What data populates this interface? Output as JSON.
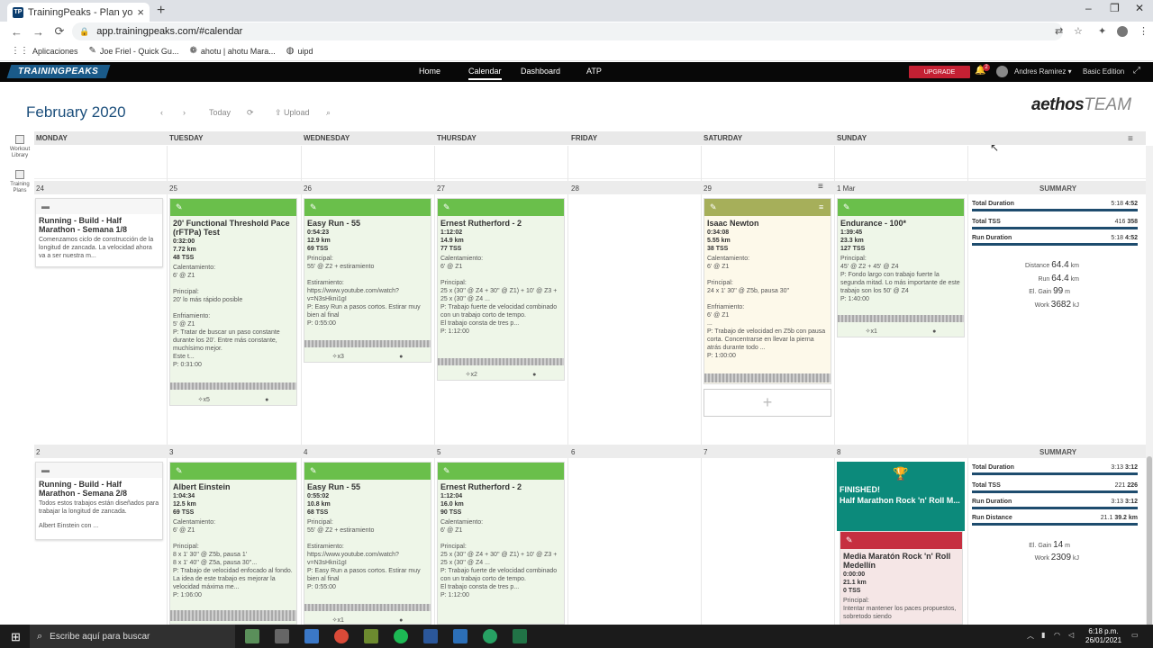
{
  "browser": {
    "tab_title": "TrainingPeaks - Plan your training",
    "tab_favicon": "TP",
    "url": "app.trainingpeaks.com/#calendar",
    "bookmarks": [
      "Aplicaciones",
      "Joe Friel - Quick Gu...",
      "ahotu | ahotu Mara...",
      "uipd"
    ]
  },
  "tp": {
    "logo": "TRAININGPEAKS",
    "nav": [
      "Home",
      "Calendar",
      "Dashboard",
      "ATP"
    ],
    "upgrade": "UPGRADE",
    "bell_count": "2",
    "user": "Andres Ramirez",
    "edition": "Basic Edition"
  },
  "calendar": {
    "month": "February",
    "year": "2020",
    "today": "Today",
    "upload": "Upload",
    "brand_main": "aethos",
    "brand_team": "TEAM",
    "side_library": "Workout Library",
    "side_plans": "Training Plans",
    "days": [
      "MONDAY",
      "TUESDAY",
      "WEDNESDAY",
      "THURSDAY",
      "FRIDAY",
      "SATURDAY",
      "SUNDAY"
    ],
    "summary": "SUMMARY"
  },
  "week1": {
    "dates": [
      "24",
      "25",
      "26",
      "27",
      "28",
      "29",
      "1 Mar"
    ],
    "plan": {
      "name": "Running - Build - Half Marathon - Semana 1/8",
      "desc": "Comenzamos ciclo de construcción de la longitud de zancada. La velocidad ahora va a ser nuestra m..."
    },
    "tue": {
      "name": "20' Functional Threshold Pace (rFTPa) Test",
      "dur": "0:32:00",
      "dist": "7.72 km",
      "tss": "48 TSS",
      "desc1": "Calentamiento:",
      "desc2": "6' @ Z1",
      "desc3": "Principal:",
      "desc4": "20' lo más rápido posible",
      "desc5": "Enfriamiento:",
      "desc6": "5' @ Z1",
      "desc7": "P: Tratar de buscar un paso constante durante los 20'. Entre más constante, muchísimo mejor.",
      "desc8": "Este t...",
      "desc9": "P: 0:31:00",
      "count": "x5"
    },
    "wed": {
      "name": "Easy Run - 55",
      "dur": "0:54:23",
      "dist": "12.9 km",
      "tss": "69 TSS",
      "desc1": "Principal:",
      "desc2": "55' @ Z2 + estiramiento",
      "desc3": "Estiramiento:",
      "desc4": "https://www.youtube.com/watch?v=N3sHkni1gI",
      "desc5": "P: Easy Run a pasos cortos. Estirar muy bien al final",
      "desc6": "P: 0:55:00",
      "count": "x3"
    },
    "thu": {
      "name": "Ernest Rutherford - 2",
      "dur": "1:12:02",
      "dist": "14.9 km",
      "tss": "77 TSS",
      "desc1": "Calentamiento:",
      "desc2": "6' @ Z1",
      "desc3": "Principal:",
      "desc4": "25 x (30'' @ Z4 + 30'' @ Z1) + 10' @ Z3 + 25 x (30'' @ Z4 ...",
      "desc5": "P: Trabajo fuerte de velocidad combinado con un trabajo corto de tempo.",
      "desc6": "El trabajo consta de tres p...",
      "desc7": "P: 1:12:00",
      "count": "x2"
    },
    "sat": {
      "name": "Isaac Newton",
      "dur": "0:34:08",
      "dist": "5.55 km",
      "tss": "38 TSS",
      "desc1": "Calentamiento:",
      "desc2": "6' @ Z1",
      "desc3": "Principal:",
      "desc4": "24 x 1' 30'' @ Z5b, pausa 30''",
      "desc5": "Enfriamiento:",
      "desc6": "6' @ Z1",
      "desc7": "...",
      "desc8": "P: Trabajo de velocidad en Z5b con pausa corta. Concentrarse en llevar la pierna atrás durante todo ...",
      "desc9": "P: 1:00:00"
    },
    "sun": {
      "name": "Endurance - 100*",
      "dur": "1:39:45",
      "dist": "23.3 km",
      "tss": "127 TSS",
      "desc1": "Principal:",
      "desc2": "45' @ Z2 + 45' @ Z4",
      "desc3": "P: Fondo largo con trabajo fuerte la segunda mitad. Lo más importante de este trabajo son los 50' @ Z4",
      "desc4": "P: 1:40:00",
      "count": "x1"
    },
    "summary": {
      "rows": [
        {
          "label": "Total Duration",
          "a": "5:18",
          "b": "4:52"
        },
        {
          "label": "Total TSS",
          "a": "416",
          "b": "358"
        },
        {
          "label": "Run Duration",
          "a": "5:18",
          "b": "4:52"
        }
      ],
      "stats": [
        {
          "label": "Distance",
          "value": "64.4",
          "unit": "km"
        },
        {
          "label": "Run",
          "value": "64.4",
          "unit": "km"
        },
        {
          "label": "El. Gain",
          "value": "99",
          "unit": "m"
        },
        {
          "label": "Work",
          "value": "3682",
          "unit": "kJ"
        }
      ]
    }
  },
  "week2": {
    "dates": [
      "2",
      "3",
      "4",
      "5",
      "6",
      "7",
      "8"
    ],
    "plan": {
      "name": "Running - Build - Half Marathon - Semana 2/8",
      "desc": "Todos estos trabajos están diseñados para trabajar la longitud de zancada.",
      "desc2": "Albert Einstein con ..."
    },
    "tue": {
      "name": "Albert Einstein",
      "dur": "1:04:34",
      "dist": "12.5 km",
      "tss": "69 TSS",
      "desc1": "Calentamiento:",
      "desc2": "6' @ Z1",
      "desc3": "Principal:",
      "desc4": "8 x 1' 30'' @ Z5b, pausa 1'",
      "desc5": "8 x 1' 40'' @ Z5a, pausa 30''...",
      "desc6": "P: Trabajo de velocidad enfocado al fondo. La idea de este trabajo es mejorar la velocidad máxima me...",
      "desc7": "P: 1:06:00"
    },
    "wed": {
      "name": "Easy Run - 55",
      "dur": "0:55:02",
      "dist": "10.8 km",
      "tss": "68 TSS",
      "desc1": "Principal:",
      "desc2": "55' @ Z2 + estiramiento",
      "desc3": "Estiramiento:",
      "desc4": "https://www.youtube.com/watch?v=N3sHkni1gI",
      "desc5": "P: Easy Run a pasos cortos. Estirar muy bien al final",
      "desc6": "P: 0:55:00",
      "count": "x1"
    },
    "thu": {
      "name": "Ernest Rutherford - 2",
      "dur": "1:12:04",
      "dist": "16.0 km",
      "tss": "90 TSS",
      "desc1": "Calentamiento:",
      "desc2": "6' @ Z1",
      "desc3": "Principal:",
      "desc4": "25 x (30'' @ Z4 + 30'' @ Z1) + 10' @ Z3 + 25 x (30'' @ Z4 ...",
      "desc5": "P: Trabajo fuerte de velocidad combinado con un trabajo corto de tempo.",
      "desc6": "El trabajo consta de tres p...",
      "desc7": "P: 1:12:00"
    },
    "sun_finished": {
      "t1": "FINISHED!",
      "t2": "Half Marathon Rock 'n' Roll M..."
    },
    "sun_event": {
      "name": "Media Maratón Rock 'n' Roll Medellín",
      "dur": "0:00:00",
      "dist": "21.1 km",
      "tss": "0 TSS",
      "desc1": "Principal:",
      "desc2": "Intentar mantener los paces propuestos, sobretodo siendo"
    },
    "summary": {
      "rows": [
        {
          "label": "Total Duration",
          "a": "3:13",
          "b": "3:12"
        },
        {
          "label": "Total TSS",
          "a": "221",
          "b": "226"
        },
        {
          "label": "Run Duration",
          "a": "3:13",
          "b": "3:12"
        },
        {
          "label": "Run Distance",
          "a": "21.1",
          "b": "39.2 km"
        }
      ],
      "stats": [
        {
          "label": "El. Gain",
          "value": "14",
          "unit": "m"
        },
        {
          "label": "Work",
          "value": "2309",
          "unit": "kJ"
        }
      ]
    }
  },
  "taskbar": {
    "search": "Escribe aquí para buscar",
    "time": "6:18 p.m.",
    "date": "26/01/2021"
  },
  "colors": {
    "green": "#6abf4b",
    "teal": "#0c8a7b",
    "red": "#c62f40",
    "navy": "#1c4f7c"
  }
}
